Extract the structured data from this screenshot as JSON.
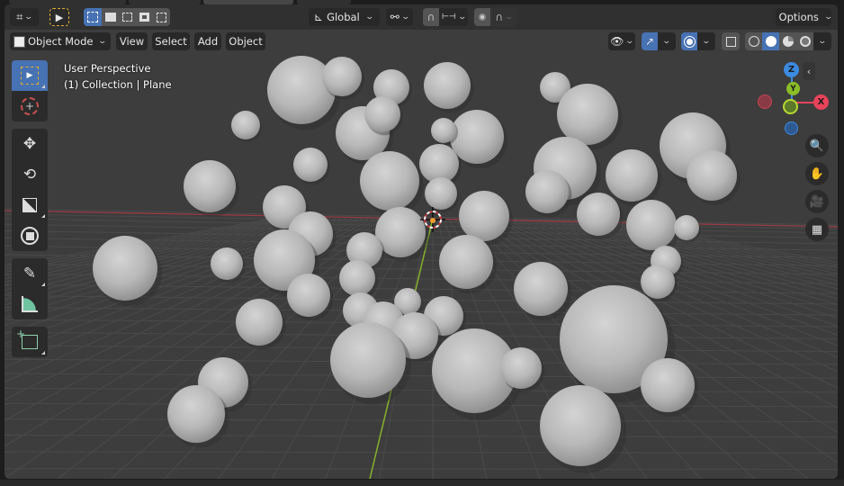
{
  "header": {
    "editor_type_icon": "3d-viewport-icon",
    "select_tool_icon": "cursor-icon",
    "selection_modes": [
      "set-new-selection",
      "extend-selection",
      "subtract-selection",
      "invert-selection",
      "intersect-selection"
    ],
    "transform_orientation": "Global",
    "pivot_icon": "pivot-link-icon",
    "snap_icon": "magnet-icon",
    "snap_element_icon": "snap-increment-icon",
    "proportional_edit_icon": "proportional-edit-icon",
    "falloff_icon": "falloff-curve-icon",
    "options_label": "Options"
  },
  "header2": {
    "mode_label": "Object Mode",
    "menus": [
      "View",
      "Select",
      "Add",
      "Object"
    ],
    "visibility_icon": "eye-icon",
    "gizmo_icon": "gizmo-icon",
    "overlay_icon": "overlay-icon",
    "xray_icon": "xray-icon",
    "shading_modes": [
      "wireframe",
      "solid",
      "material-preview",
      "rendered"
    ],
    "active_shading": "solid"
  },
  "viewport": {
    "view_name": "User Perspective",
    "collection_info": "(1) Collection | Plane"
  },
  "toolbar": {
    "tools": [
      {
        "name": "select-box",
        "icon": "select-box-icon",
        "active": true
      },
      {
        "name": "cursor",
        "icon": "3d-cursor-icon",
        "active": false
      },
      {
        "name": "move",
        "icon": "move-icon",
        "active": false
      },
      {
        "name": "rotate",
        "icon": "rotate-icon",
        "active": false
      },
      {
        "name": "scale",
        "icon": "scale-icon",
        "active": false
      },
      {
        "name": "transform",
        "icon": "transform-icon",
        "active": false
      },
      {
        "name": "annotate",
        "icon": "annotate-icon",
        "active": false
      },
      {
        "name": "measure",
        "icon": "measure-icon",
        "active": false
      },
      {
        "name": "add-cube",
        "icon": "add-cube-icon",
        "active": false
      }
    ]
  },
  "gizmo": {
    "axes": [
      "Z",
      "Y",
      "X"
    ],
    "colors": {
      "x": "#e8435a",
      "y": "#8bbd27",
      "z": "#3b8ae0"
    }
  },
  "nav_buttons": [
    "zoom-icon",
    "hand-pan-icon",
    "camera-icon",
    "ortho-grid-icon"
  ],
  "colors": {
    "accent": "#4772b3",
    "background": "#3d3d3d",
    "header": "#303030",
    "button": "#282828",
    "x_axis": "#b8424c",
    "y_axis": "#86b22c",
    "cursor_orange": "#f0a030"
  }
}
